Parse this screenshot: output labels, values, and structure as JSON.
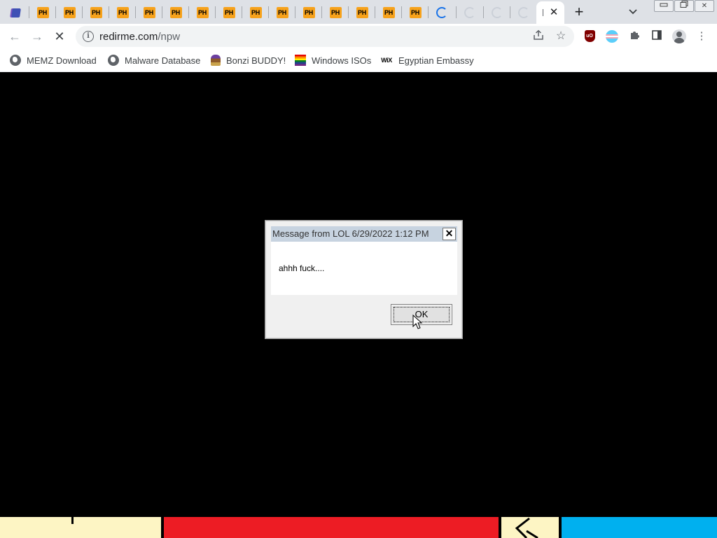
{
  "browser": {
    "tabs": {
      "loading_favicons": [
        "PH",
        "PH",
        "PH",
        "PH",
        "PH",
        "PH",
        "PH",
        "PH",
        "PH",
        "PH",
        "PH",
        "PH",
        "PH",
        "PH",
        "PH"
      ],
      "close_symbol": "✕"
    },
    "new_tab_symbol": "+",
    "tab_search_symbol": "⌄",
    "window_controls": {
      "minimize": "▭",
      "restore": "⧉",
      "close": "✕"
    },
    "toolbar": {
      "back_symbol": "←",
      "forward_symbol": "→",
      "reload_symbol": "✕",
      "info_symbol": "i",
      "url_host": "redirme.com",
      "url_path": "/npw",
      "share_symbol": "⇪",
      "star_symbol": "☆",
      "extension_ublock": "uO",
      "puzzle_symbol": "✤",
      "sidepanel_symbol": "▯",
      "menu_symbol": "⋮"
    },
    "bookmarks": [
      {
        "label": "MEMZ Download",
        "icon": "globe-icon"
      },
      {
        "label": "Malware Database",
        "icon": "globe-icon"
      },
      {
        "label": "Bonzi BUDDY!",
        "icon": "bonzi-icon"
      },
      {
        "label": "Windows ISOs",
        "icon": "rainbow-flag-icon"
      },
      {
        "label": "Egyptian Embassy",
        "icon": "wix-icon",
        "icon_text": "WiX"
      }
    ]
  },
  "dialog": {
    "title": "Message from LOL 6/29/2022 1:12 PM",
    "close_symbol": "✕",
    "message": "ahhh fuck....",
    "ok_label": "OK"
  },
  "colors": {
    "page_background": "#000000",
    "tab_favicon": "#f7a21b",
    "strip_colors": [
      "#fdf5c4",
      "#ed1c24",
      "#fdf5c4",
      "#00b0ef"
    ]
  }
}
